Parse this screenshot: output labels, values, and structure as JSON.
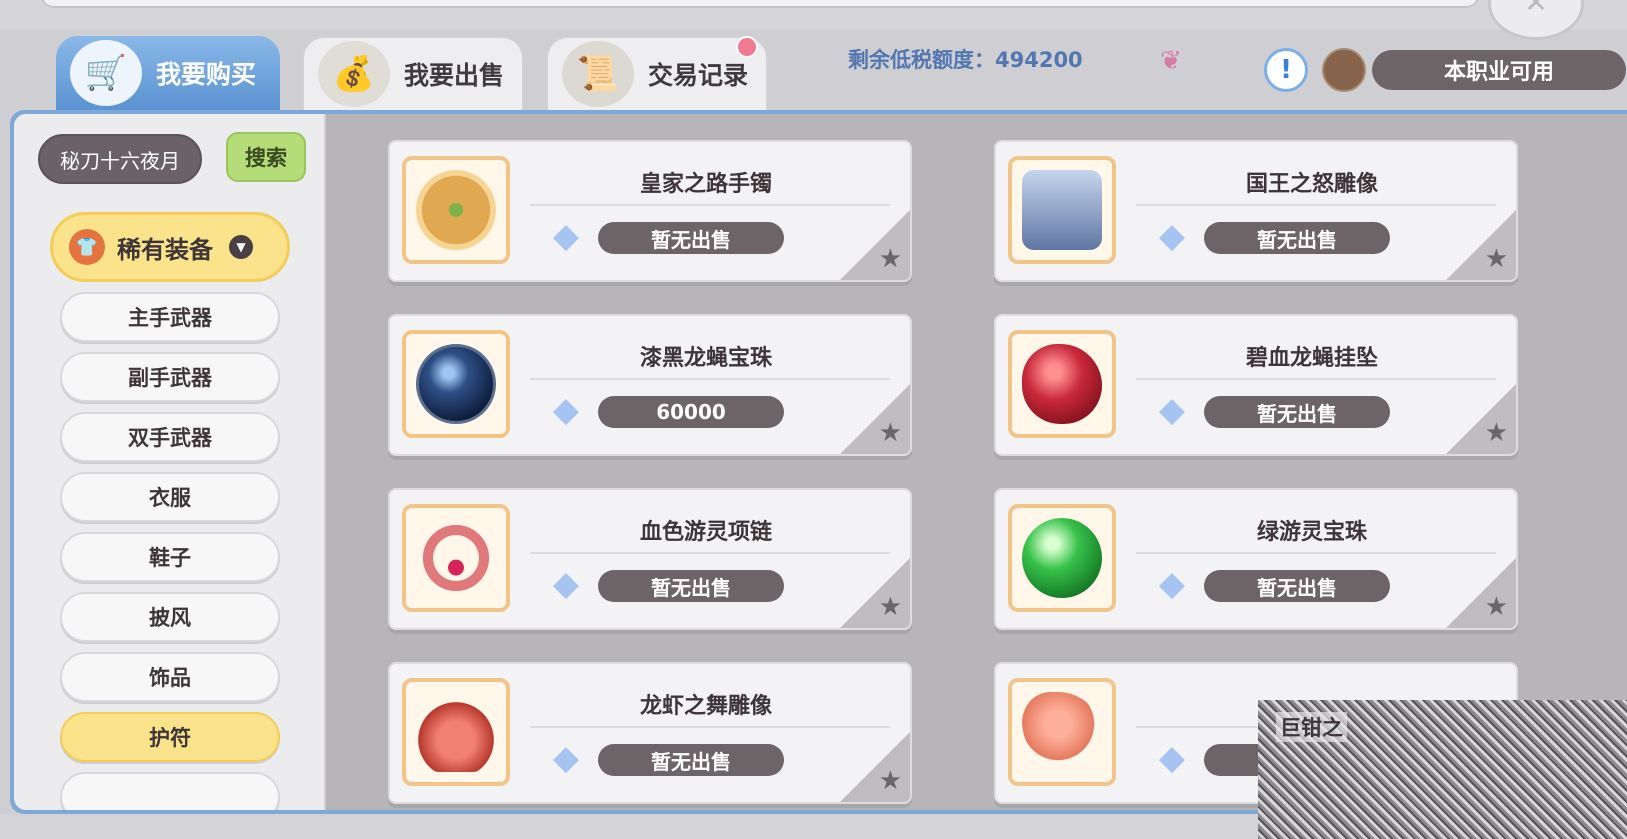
{
  "tabs": [
    {
      "label": "我要购买",
      "icon": "shopping-cart-icon",
      "active": true
    },
    {
      "label": "我要出售",
      "icon": "money-bag-icon",
      "active": false
    },
    {
      "label": "交易记录",
      "icon": "record-scroll-icon",
      "active": false
    }
  ],
  "header": {
    "tax_label": "剩余低税额度：494200",
    "job_filter": "本职业可用",
    "info_icon": "!"
  },
  "sidebar": {
    "search_value": "秘刀十六夜月",
    "search_button": "搜索",
    "category": "稀有装备",
    "sub_items": [
      "主手武器",
      "副手武器",
      "双手武器",
      "衣服",
      "鞋子",
      "披风",
      "饰品",
      "护符"
    ],
    "selected_sub": "护符"
  },
  "items": [
    {
      "name": "皇家之路手镯",
      "price": "暂无出售",
      "art": "bracelet",
      "color": "#e0a850"
    },
    {
      "name": "国王之怒雕像",
      "price": "暂无出售",
      "art": "crown-statue",
      "color": "#8fa6cc"
    },
    {
      "name": "漆黑龙蝇宝珠",
      "price": "60000",
      "art": "dark-orb",
      "color": "#223a66"
    },
    {
      "name": "碧血龙蝇挂坠",
      "price": "暂无出售",
      "art": "red-pendant",
      "color": "#c8283a"
    },
    {
      "name": "血色游灵项链",
      "price": "暂无出售",
      "art": "necklace",
      "color": "#e07a7a"
    },
    {
      "name": "绿游灵宝珠",
      "price": "暂无出售",
      "art": "green-orb",
      "color": "#2ea43c"
    },
    {
      "name": "龙虾之舞雕像",
      "price": "暂无出售",
      "art": "lobster-statue",
      "color": "#d0584a"
    },
    {
      "name": "",
      "price": "",
      "art": "claw",
      "color": "#e47a5e"
    }
  ],
  "overlay_label": "巨钳之"
}
